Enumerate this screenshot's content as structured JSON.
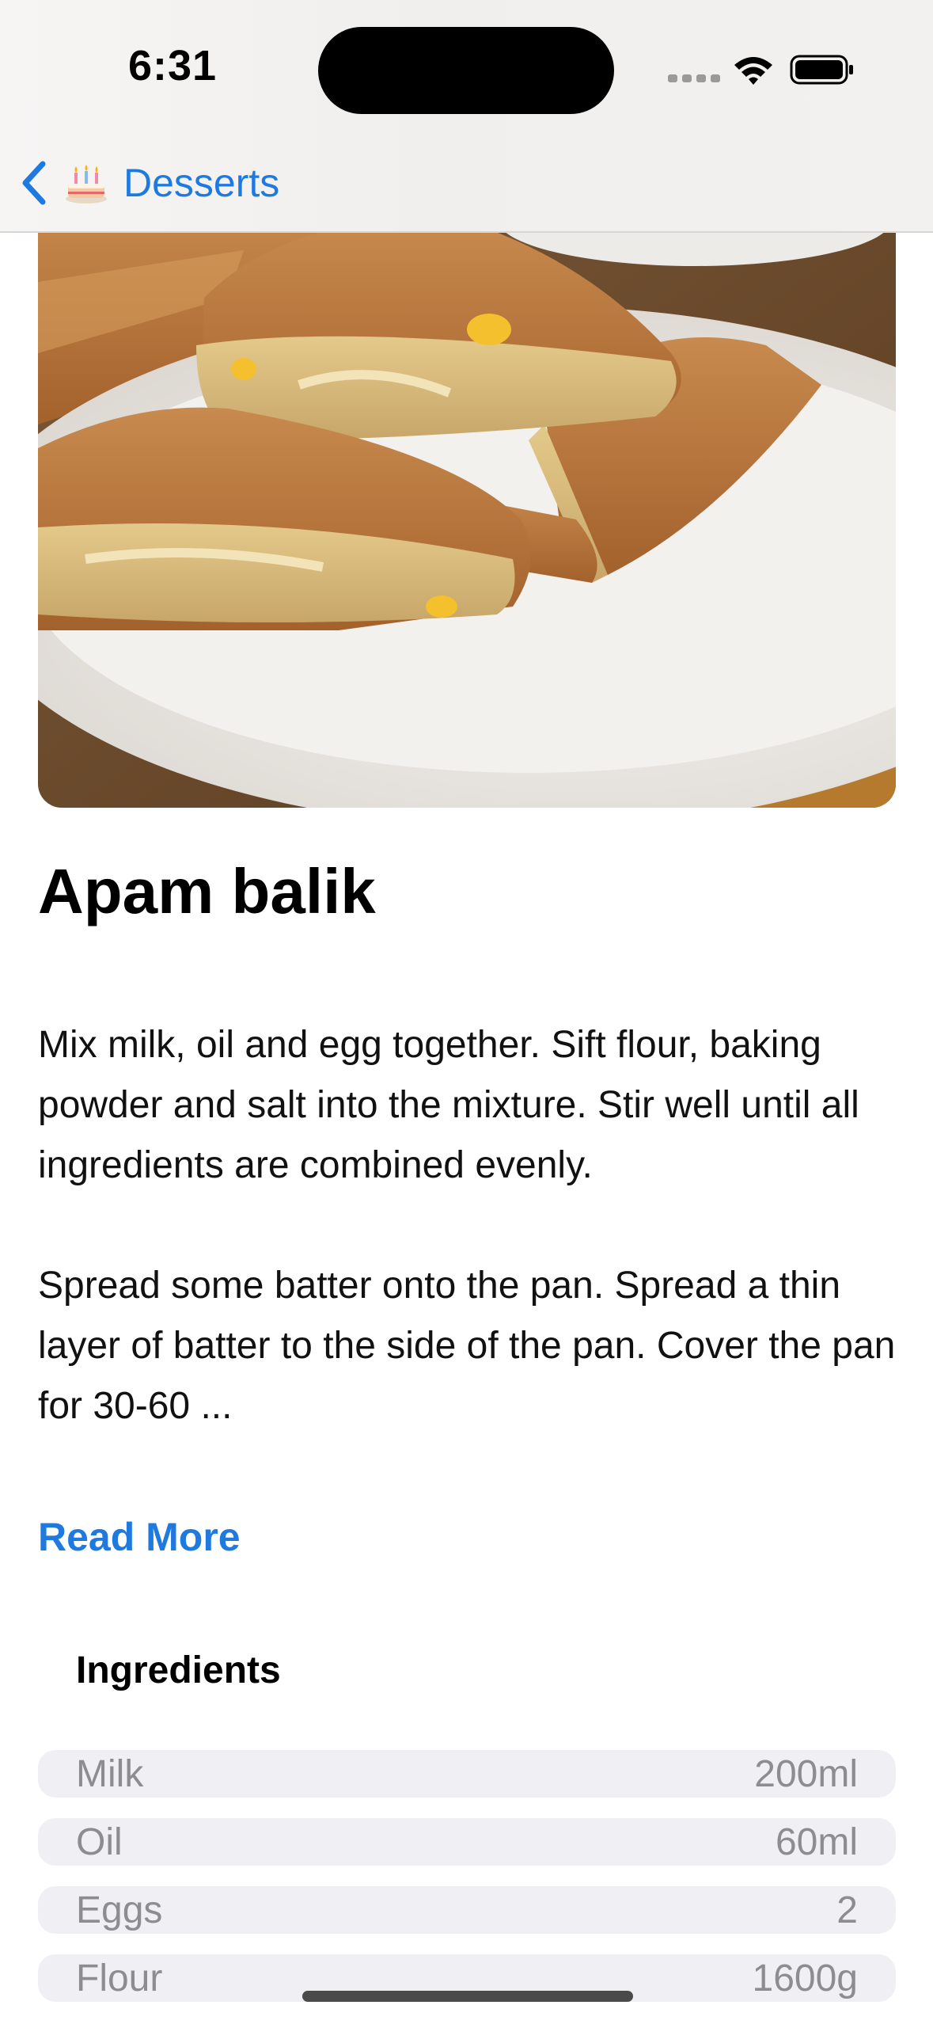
{
  "status_bar": {
    "time": "6:31"
  },
  "nav": {
    "back_label": "Desserts",
    "back_icon": "chevron-left-icon",
    "category_icon": "cake-icon"
  },
  "recipe": {
    "title": "Apam balik",
    "instructions": [
      "Mix milk, oil and egg together. Sift flour, baking powder and salt into the mixture. Stir well until all ingredients are combined evenly.",
      "Spread some batter onto the pan. Spread a thin layer of batter to the side of the pan. Cover the pan for 30-60 ..."
    ],
    "read_more_label": "Read More"
  },
  "ingredients": {
    "heading": "Ingredients",
    "items": [
      {
        "name": "Milk",
        "amount": "200ml"
      },
      {
        "name": "Oil",
        "amount": "60ml"
      },
      {
        "name": "Eggs",
        "amount": "2"
      },
      {
        "name": "Flour",
        "amount": "1600g"
      }
    ]
  },
  "colors": {
    "accent": "#1f7ae0",
    "row_background": "#f0f0f4",
    "row_text": "#8c8c92"
  }
}
